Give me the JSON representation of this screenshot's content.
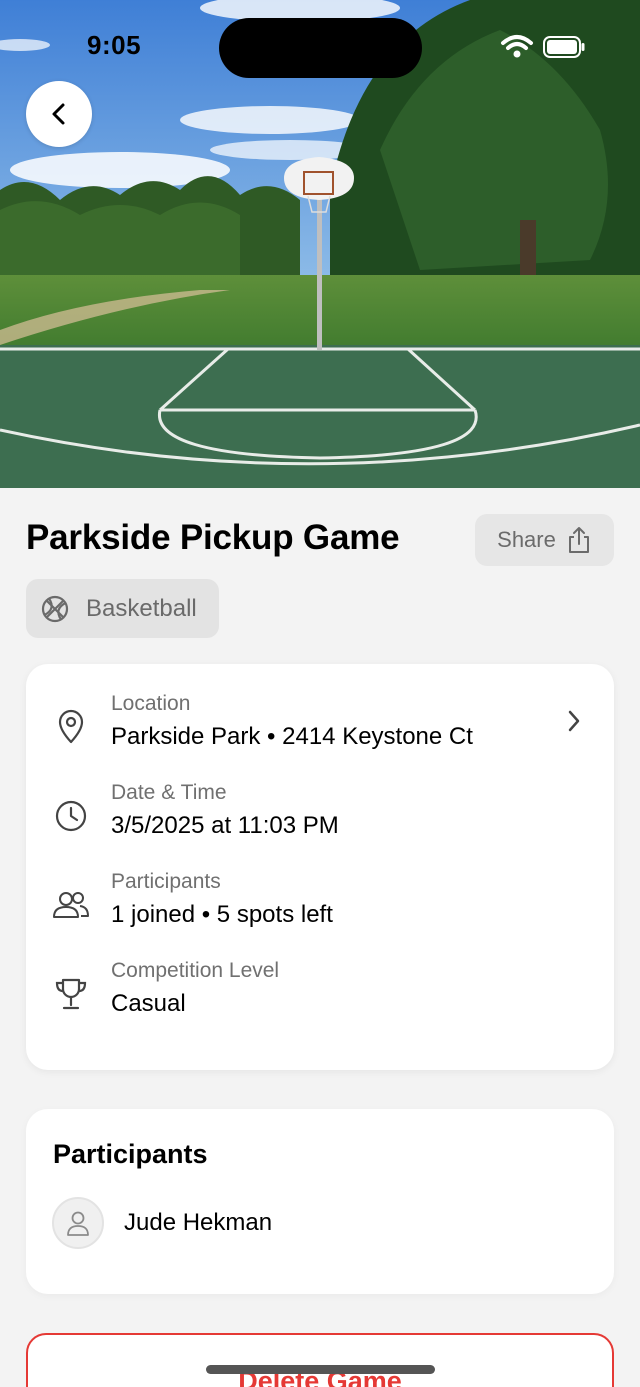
{
  "status_bar": {
    "time": "9:05"
  },
  "hero": {
    "image_description_icon": "basketball-court-photo"
  },
  "nav": {
    "back_icon": "chevron-left-icon"
  },
  "game": {
    "title": "Parkside Pickup Game",
    "share_label": "Share",
    "sport_label": "Basketball"
  },
  "details": [
    {
      "icon": "location-pin-icon",
      "label": "Location",
      "value": "Parkside Park • 2414 Keystone Ct"
    },
    {
      "icon": "clock-icon",
      "label": "Date & Time",
      "value": "3/5/2025 at 11:03 PM"
    },
    {
      "icon": "people-icon",
      "label": "Participants",
      "value": "1 joined • 5 spots left"
    },
    {
      "icon": "trophy-icon",
      "label": "Competition Level",
      "value": "Casual"
    }
  ],
  "participants": {
    "title": "Participants",
    "list": [
      {
        "name": "Jude Hekman"
      }
    ]
  },
  "actions": {
    "delete_label": "Delete Game"
  },
  "colors": {
    "danger": "#e53935",
    "court": "#3d6e50",
    "background": "#f3f3f3"
  }
}
